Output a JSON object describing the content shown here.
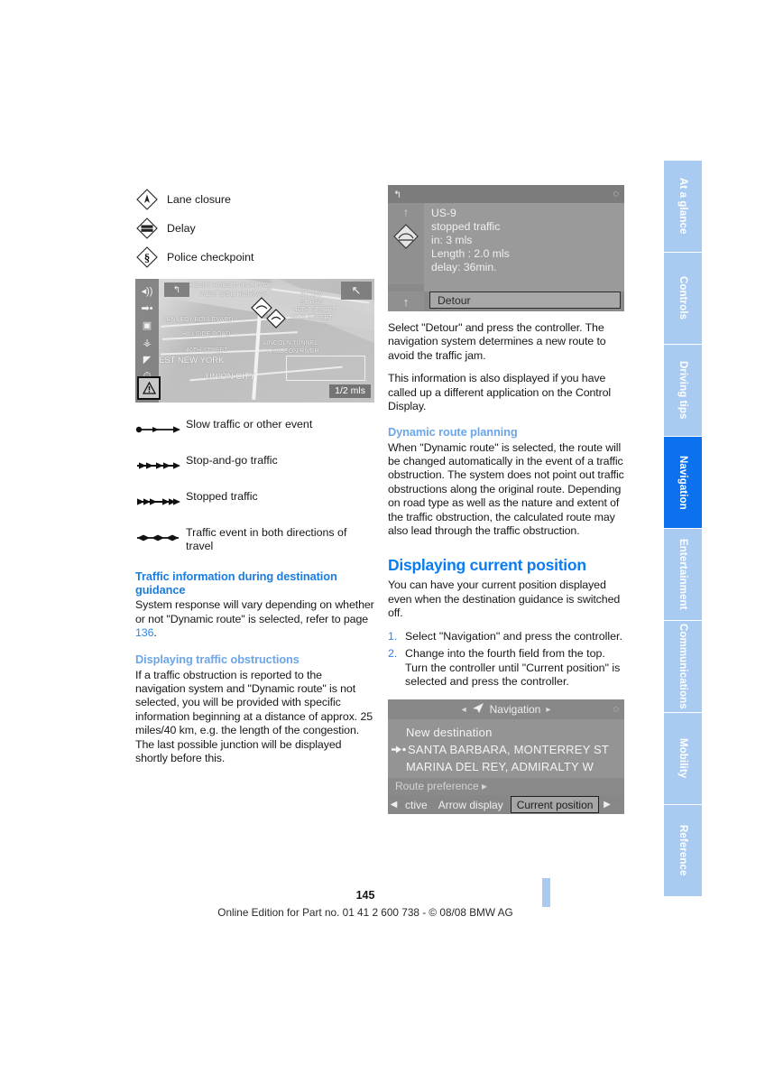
{
  "document": {
    "page_number": "145",
    "footer_text": "Online Edition for Part no. 01 41 2 600 738 - © 08/08 BMW AG"
  },
  "index_tabs": [
    {
      "label": "At a glance",
      "active": false
    },
    {
      "label": "Controls",
      "active": false
    },
    {
      "label": "Driving tips",
      "active": false
    },
    {
      "label": "Navigation",
      "active": true
    },
    {
      "label": "Entertainment",
      "active": false
    },
    {
      "label": "Communications",
      "active": false
    },
    {
      "label": "Mobility",
      "active": false
    },
    {
      "label": "Reference",
      "active": false
    }
  ],
  "colors": {
    "tab_inactive": "#a9cbf2",
    "tab_active": "#0b71ee",
    "heading_blue": "#0a7cf0",
    "subheading_blue": "#1a7de0",
    "subheading_light_blue": "#6ba6e8",
    "link_blue": "#2f86e8"
  },
  "left_column": {
    "symbol_legend": [
      {
        "icon": "lane-closure-diamond-icon",
        "label": "Lane closure"
      },
      {
        "icon": "delay-diamond-icon",
        "label": "Delay"
      },
      {
        "icon": "police-checkpoint-diamond-icon",
        "label": "Police checkpoint"
      }
    ],
    "map_figure": {
      "scale_label": "1/2 mls",
      "toolbar_icons": [
        "speaker-volume-icon",
        "route-arrow-icon",
        "split-screen-icon",
        "pedestrian-icon",
        "direction-arrow-icon",
        "clock-icon"
      ],
      "warning_icon": "traffic-warning-triangle-icon",
      "back_icon": "back-arrow-icon",
      "expand_icon": "expand-arrow-icon",
      "street_labels": [
        "HENRY HUDSON PARKWAY",
        "WEST SIDE HIGHWAY",
        "KENNEDY BOULEVARD",
        "HILLSIDE ROAD",
        "40TH STREET",
        "ST HAV",
        "ST HAV",
        "40TH STREET",
        "40TH STREET",
        "LINCOLN TUNNEL",
        "/ HUDSON RIVER",
        "EST NEW YORK",
        "UNION CITY"
      ]
    },
    "traffic_line_legend": [
      {
        "glyph": "slow-traffic-line-icon",
        "label": "Slow traffic or other event"
      },
      {
        "glyph": "stop-and-go-traffic-line-icon",
        "label": "Stop-and-go traffic"
      },
      {
        "glyph": "stopped-traffic-line-icon",
        "label": "Stopped traffic"
      },
      {
        "glyph": "both-directions-traffic-line-icon",
        "label": "Traffic event in both directions of travel"
      }
    ],
    "section_traffic_info": {
      "heading": "Traffic information during destination guidance",
      "paragraph_before": "System response will vary depending on whether or not \"Dynamic route\" is selected, refer to page ",
      "page_ref": "136",
      "paragraph_after": "."
    },
    "section_obstructions": {
      "heading": "Displaying traffic obstructions",
      "paragraph1": "If a traffic obstruction is reported to the navigation system and \"Dynamic route\" is not selected, you will be provided with specific information beginning at a distance of approx. 25 miles/40 km, e.g. the length of the congestion.",
      "paragraph2": "The last possible junction will be displayed shortly before this."
    }
  },
  "right_column": {
    "traffic_screen": {
      "back_icon": "back-arrow-icon",
      "status_icon": "compass-icon",
      "event_icon": "stopped-traffic-diamond-icon",
      "up_icon": "up-arrow-icon",
      "lines": [
        "US-9",
        "stopped traffic",
        "in: 3 mls",
        "Length : 2.0 mls",
        "delay: 36min."
      ],
      "button_label": "Detour"
    },
    "paragraph1": "Select \"Detour\" and press the controller. The navigation system determines a new route to avoid the traffic jam.",
    "paragraph2": "This information is also displayed if you have called up a different application on the Control Display.",
    "section_dynamic": {
      "heading": "Dynamic route planning",
      "paragraph": "When \"Dynamic route\" is selected, the route will be changed automatically in the event of a traffic obstruction. The system does not point out traffic obstructions along the original route. Depending on road type as well as the nature and extent of the traffic obstruction, the calculated route may also lead through the traffic obstruction."
    },
    "section_current_position": {
      "heading": "Displaying current position",
      "intro": "You can have your current position displayed even when the destination guidance is switched off.",
      "steps": [
        {
          "num": "1.",
          "text": "Select \"Navigation\" and press the controller."
        },
        {
          "num": "2.",
          "text": "Change into the fourth field from the top. Turn the controller until \"Current position\" is selected and press the controller."
        }
      ]
    },
    "nav_menu_screen": {
      "title": "Navigation",
      "title_icon": "navigation-arrow-icon",
      "left_caret": "◂",
      "right_caret": "▸",
      "status_icon": "compass-icon",
      "items": [
        {
          "label": "New destination",
          "marker": ""
        },
        {
          "label": "SANTA BARBARA, MONTERREY ST",
          "marker": "destination-arrow-icon"
        },
        {
          "label": "MARINA DEL REY, ADMIRALTY W",
          "marker": ""
        }
      ],
      "route_preference": "Route preference ▸",
      "tabs": [
        {
          "label": "ctive",
          "selected": false
        },
        {
          "label": "Arrow display",
          "selected": false
        },
        {
          "label": "Current position",
          "selected": true
        }
      ],
      "tab_left_arrow": "◀",
      "tab_right_arrow": "▶"
    }
  }
}
